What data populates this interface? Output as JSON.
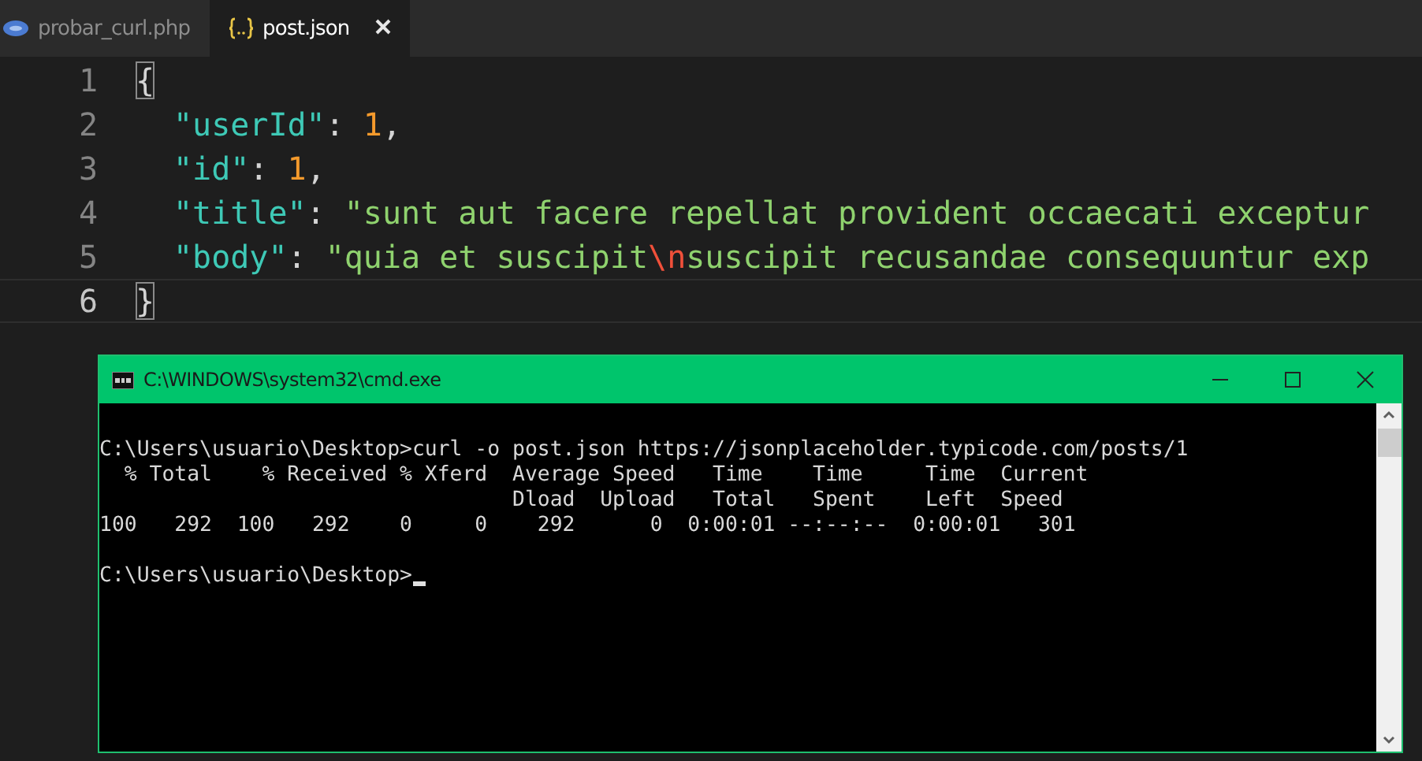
{
  "tabs": [
    {
      "label": "probar_curl.php",
      "kind": "php",
      "selected": false,
      "closable": false
    },
    {
      "label": "post.json",
      "kind": "json",
      "selected": true,
      "closable": true
    }
  ],
  "editor": {
    "lines": [
      {
        "number": "1",
        "indent": false,
        "current": false,
        "tokens": [
          {
            "kind": "bracket",
            "text": "{"
          }
        ]
      },
      {
        "number": "2",
        "indent": true,
        "current": false,
        "tokens": [
          {
            "kind": "key",
            "text": "\"userId\""
          },
          {
            "kind": "punct",
            "text": ": "
          },
          {
            "kind": "number",
            "text": "1"
          },
          {
            "kind": "punct",
            "text": ","
          }
        ]
      },
      {
        "number": "3",
        "indent": true,
        "current": false,
        "tokens": [
          {
            "kind": "key",
            "text": "\"id\""
          },
          {
            "kind": "punct",
            "text": ": "
          },
          {
            "kind": "number",
            "text": "1"
          },
          {
            "kind": "punct",
            "text": ","
          }
        ]
      },
      {
        "number": "4",
        "indent": true,
        "current": false,
        "tokens": [
          {
            "kind": "key",
            "text": "\"title\""
          },
          {
            "kind": "punct",
            "text": ": "
          },
          {
            "kind": "string",
            "text": "\"sunt aut facere repellat provident occaecati exceptur"
          }
        ]
      },
      {
        "number": "5",
        "indent": true,
        "current": false,
        "tokens": [
          {
            "kind": "key",
            "text": "\"body\""
          },
          {
            "kind": "punct",
            "text": ": "
          },
          {
            "kind": "string",
            "text": "\"quia et suscipit"
          },
          {
            "kind": "escape",
            "text": "\\n"
          },
          {
            "kind": "string",
            "text": "suscipit recusandae consequuntur exp"
          }
        ]
      },
      {
        "number": "6",
        "indent": false,
        "current": true,
        "tokens": [
          {
            "kind": "bracket",
            "text": "}"
          }
        ]
      }
    ]
  },
  "terminal": {
    "title": "C:\\WINDOWS\\system32\\cmd.exe",
    "lines": [
      {
        "kind": "blank"
      },
      {
        "kind": "output",
        "text": "C:\\Users\\usuario\\Desktop>curl -o post.json https://jsonplaceholder.typicode.com/posts/1"
      },
      {
        "kind": "output",
        "text": "  % Total    % Received % Xferd  Average Speed   Time    Time     Time  Current"
      },
      {
        "kind": "output",
        "text": "                                 Dload  Upload   Total   Spent    Left  Speed"
      },
      {
        "kind": "output",
        "text": "100   292  100   292    0     0    292      0  0:00:01 --:--:--  0:00:01   301"
      },
      {
        "kind": "blank"
      },
      {
        "kind": "prompt",
        "text": "C:\\Users\\usuario\\Desktop>"
      }
    ]
  }
}
